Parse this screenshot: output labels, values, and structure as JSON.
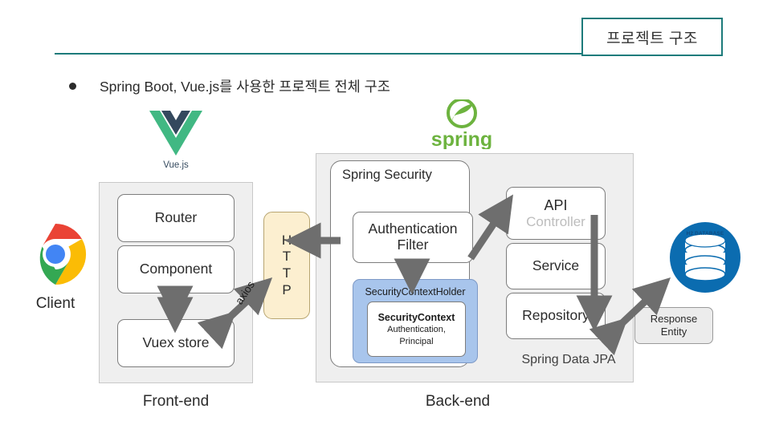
{
  "slide": {
    "title": "프로젝트 구조",
    "accent_color": "#1d7b7b",
    "bullet": "Spring Boot, Vue.js를 사용한 프로젝트 전체 구조"
  },
  "client": {
    "icon": "chrome-logo",
    "label": "Client"
  },
  "frontend": {
    "group_label": "Front-end",
    "logo_caption": "Vue.js",
    "nodes": [
      {
        "label": "Router"
      },
      {
        "label": "Component"
      },
      {
        "label": "Vuex store"
      }
    ]
  },
  "transport": {
    "http_letters": [
      "H",
      "T",
      "T",
      "P"
    ],
    "axios_label": "axios"
  },
  "backend": {
    "group_label": "Back-end",
    "logo_caption": "spring",
    "jpa_label": "Spring Data JPA",
    "security": {
      "title": "Spring Security",
      "auth_filter": "Authentication\nFilter",
      "auth_filter_line1": "Authentication",
      "auth_filter_line2": "Filter",
      "context_holder": "SecurityContextHolder",
      "context_title": "SecurityContext",
      "context_sub_line1": "Authentication,",
      "context_sub_line2": "Principal",
      "holder_color": "#a8c5ec"
    },
    "layers": [
      {
        "label_main": "API",
        "label_sub": "Controller"
      },
      {
        "label_main": "Service",
        "label_sub": ""
      },
      {
        "label_main": "Repository",
        "label_sub": ""
      }
    ]
  },
  "database": {
    "logo_text": "H2 DATABASE",
    "brand_color": "#0b6cb0",
    "response_entity_line1": "Response",
    "response_entity_line2": "Entity"
  }
}
